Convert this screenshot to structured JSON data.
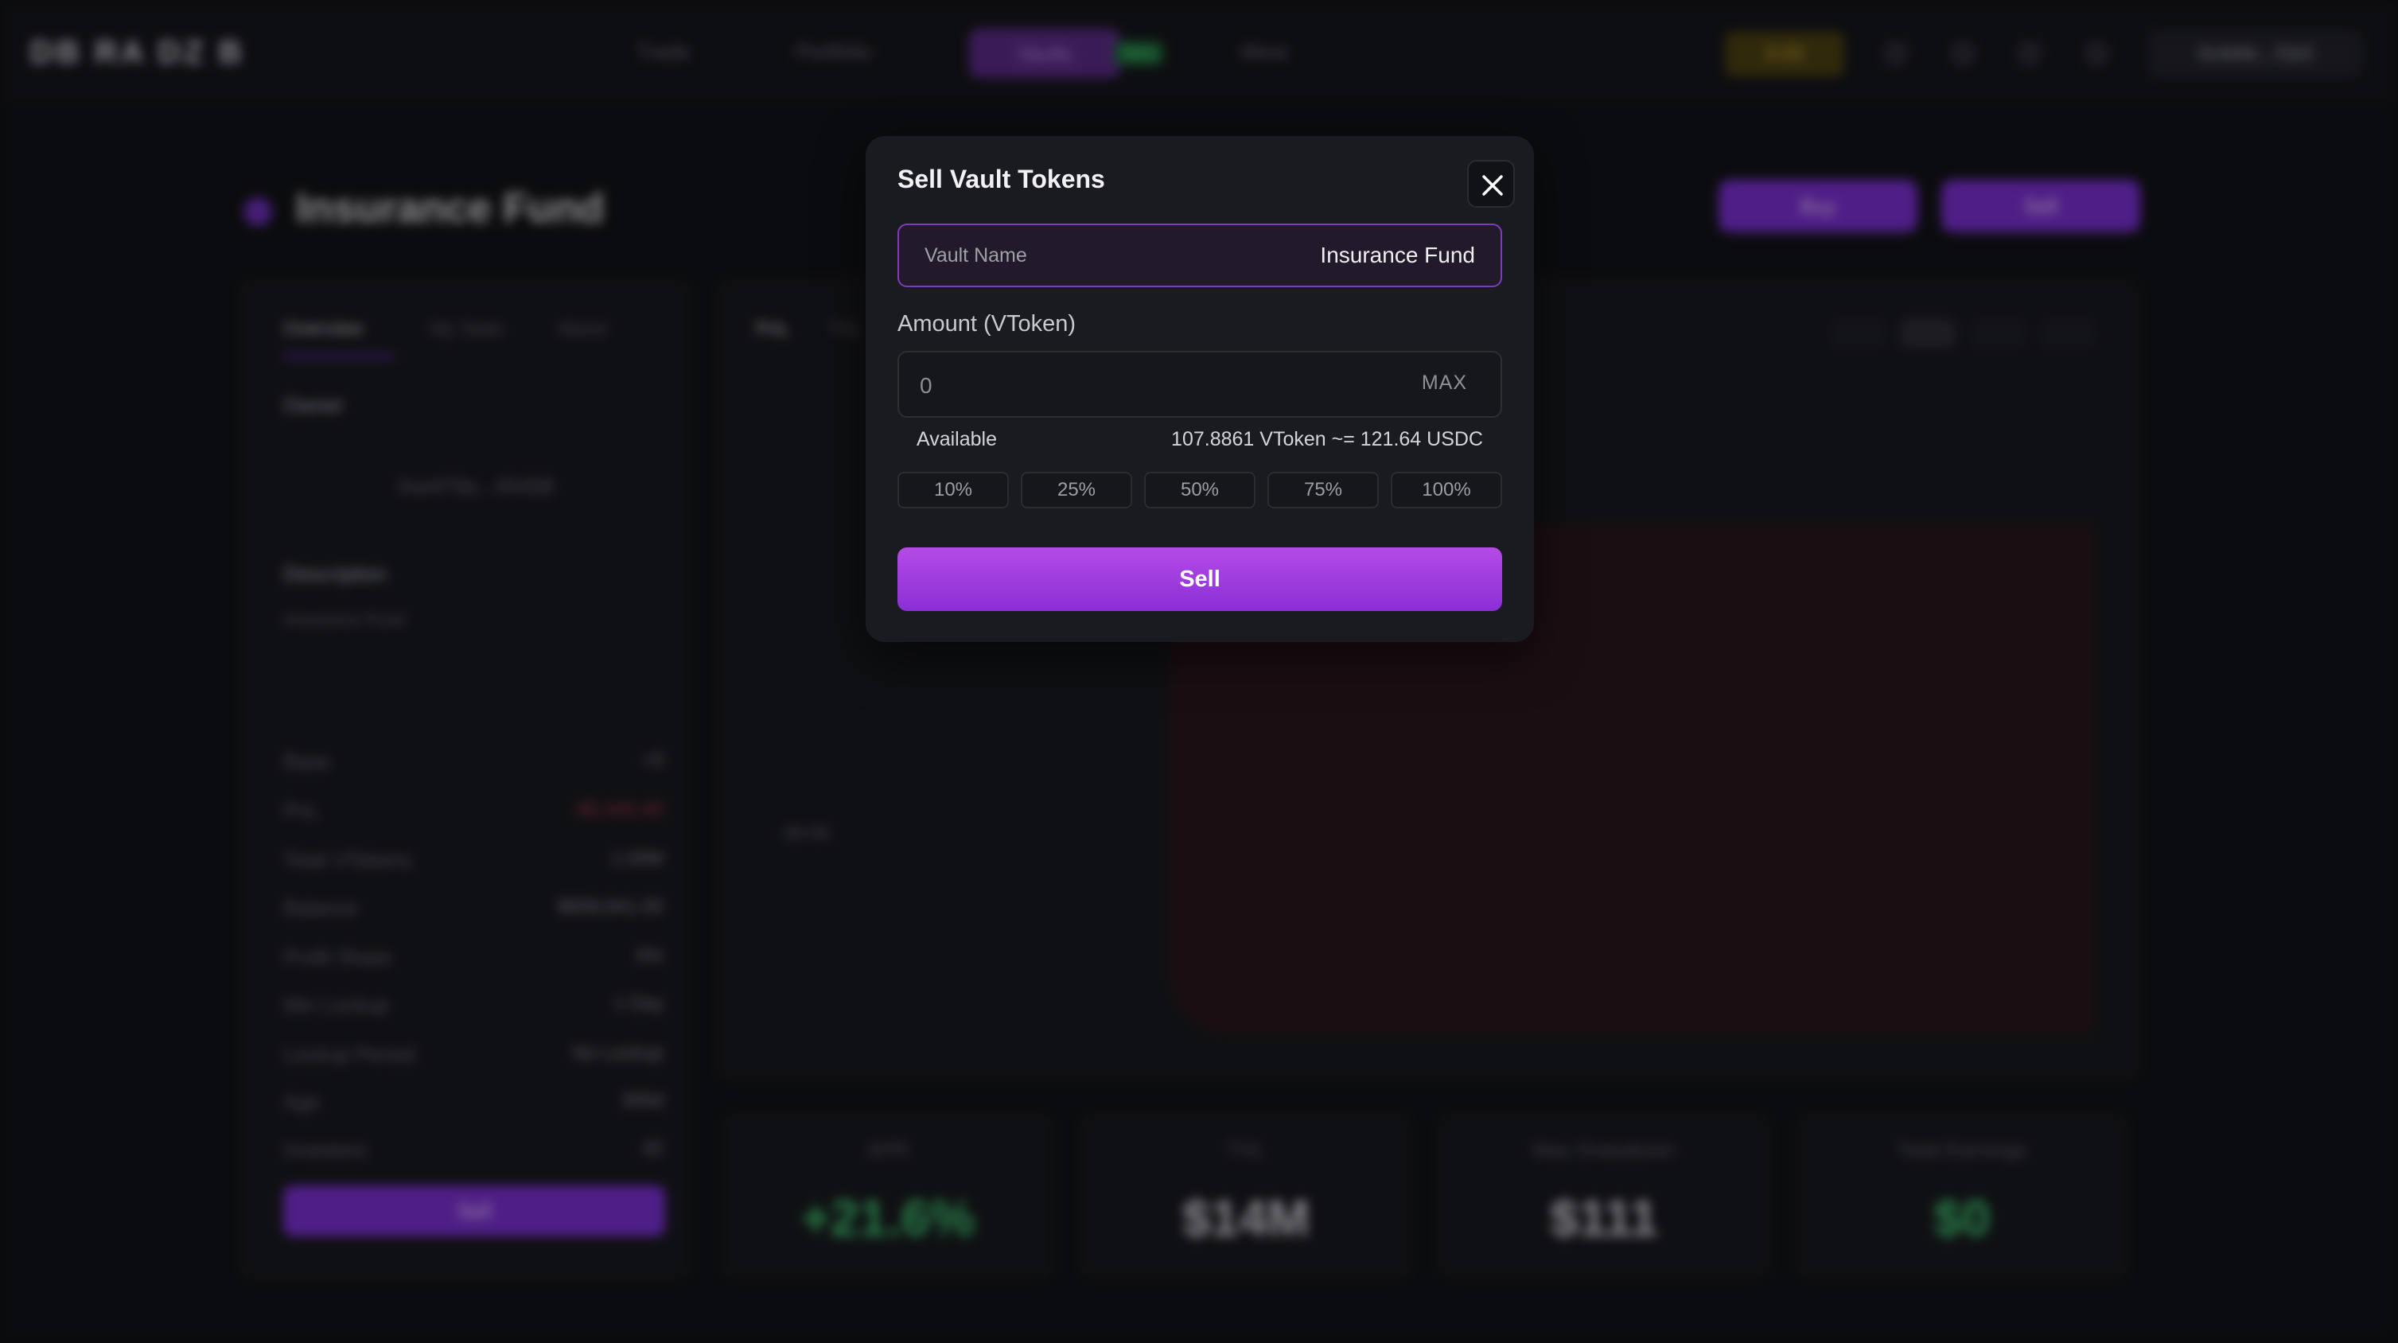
{
  "background": {
    "brand": "DB RA DZ B",
    "nav": [
      "Trade",
      "Portfolio",
      "Vaults",
      "More"
    ],
    "nav_new_badge": "New",
    "wallet_pill": "0.03",
    "account": "0x4d4c...f1b3",
    "page_title": "Insurance Fund",
    "header_buttons": [
      "Buy",
      "Sell"
    ],
    "left_tabs": [
      "Overview",
      "My Stats",
      "About"
    ],
    "owner_label": "Owner",
    "owner_value": "0xe479a...4545B",
    "description_label": "Description",
    "description_value": "Insurance Fund",
    "rows": [
      {
        "label": "Base",
        "value": "+3"
      },
      {
        "label": "PnL",
        "value": "-$2,443.40"
      },
      {
        "label": "Total VTokens",
        "value": "1.50M"
      },
      {
        "label": "Balance",
        "value": "$858,841.00"
      },
      {
        "label": "Profit Share",
        "value": "0%"
      },
      {
        "label": "Min Lockup",
        "value": "1 Day"
      },
      {
        "label": "Lockup Period",
        "value": "No Lockup"
      },
      {
        "label": "Age",
        "value": "300d"
      },
      {
        "label": "Investors",
        "value": "42"
      }
    ],
    "left_sell": "Sell",
    "chart_tabs": [
      "PnL",
      "TVL"
    ],
    "chart_ranges": [
      "1D",
      "1W",
      "1M",
      "All"
    ],
    "chart_ylabel": "-$3.0K",
    "stats": [
      {
        "label": "APR",
        "value": "+21.6%",
        "color": "#3fbf6e"
      },
      {
        "label": "TVL",
        "value": "$14M",
        "color": "#d0d0d6"
      },
      {
        "label": "Max Drawdown",
        "value": "$111",
        "color": "#d0d0d6"
      },
      {
        "label": "Total Earnings",
        "value": "$0",
        "color": "#3fbf6e"
      }
    ]
  },
  "modal": {
    "title": "Sell Vault Tokens",
    "vault_name_label": "Vault Name",
    "vault_name_value": "Insurance Fund",
    "amount_label": "Amount (VToken)",
    "amount_placeholder": "0",
    "max_label": "MAX",
    "available_label": "Available",
    "available_value": "107.8861 VToken ~= 121.64 USDC",
    "percent_options": [
      "10%",
      "25%",
      "50%",
      "75%",
      "100%"
    ],
    "sell_label": "Sell",
    "icons": {
      "close": "close-icon"
    },
    "colors": {
      "accent": "#9a3fe0",
      "border": "#7f3bbf"
    }
  }
}
